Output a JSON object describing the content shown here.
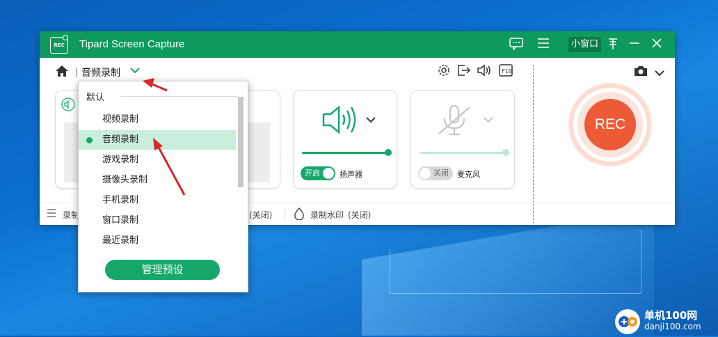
{
  "titlebar": {
    "logo_text": "REC",
    "app_title": "Tipard Screen Capture",
    "mini_window_label": "小窗口",
    "icons": [
      "feedback-icon",
      "menu-icon",
      "pin-icon",
      "minimize-icon",
      "close-icon"
    ]
  },
  "toolbar": {
    "mode_label": "音频录制",
    "icons": [
      "settings-icon",
      "export-icon",
      "sound-icon",
      "fullscreen-f10-icon",
      "camera-icon"
    ],
    "f10_label": "F10"
  },
  "speaker_card": {
    "toggle_label": "开启",
    "label": "扬声器",
    "volume": 1.0,
    "enabled": true
  },
  "mic_card": {
    "toggle_label": "关闭",
    "label": "麦克风",
    "volume": 1.0,
    "enabled": false
  },
  "rec_button": {
    "label": "REC"
  },
  "bottom_bar": {
    "left_fragment": "录制",
    "middle_fragment": "(关闭)",
    "watermark_label": "录制水印",
    "watermark_status": "(关闭)"
  },
  "dropdown": {
    "header": "默认",
    "items": [
      {
        "label": "视频录制",
        "selected": false
      },
      {
        "label": "音频录制",
        "selected": true
      },
      {
        "label": "游戏录制",
        "selected": false
      },
      {
        "label": "摄像头录制",
        "selected": false
      },
      {
        "label": "手机录制",
        "selected": false
      },
      {
        "label": "窗口录制",
        "selected": false
      },
      {
        "label": "最近录制",
        "selected": false
      }
    ],
    "manage_button": "管理预设"
  },
  "watermark": {
    "line1": "单机100网",
    "line2": "danji100.com"
  },
  "colors": {
    "brand_green": "#0e9a5e",
    "accent_green": "#16a86a",
    "rec_orange": "#ed5a36"
  }
}
